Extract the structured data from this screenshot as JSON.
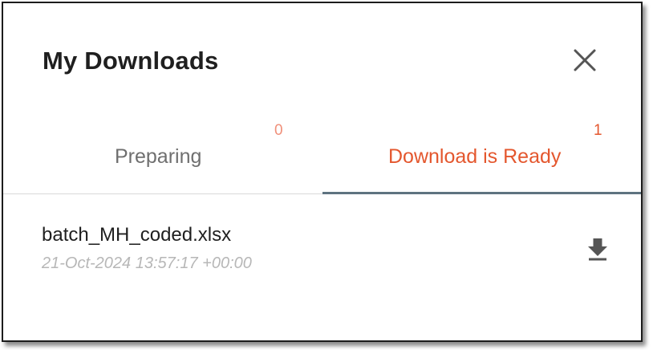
{
  "dialog": {
    "title": "My Downloads",
    "close_icon": "close-icon"
  },
  "tabs": [
    {
      "label": "Preparing",
      "count": "0",
      "active": false
    },
    {
      "label": "Download is Ready",
      "count": "1",
      "active": true
    }
  ],
  "downloads": [
    {
      "file_name": "batch_MH_coded.xlsx",
      "timestamp": "21-Oct-2024 13:57:17 +00:00",
      "action_icon": "download-icon"
    }
  ],
  "colors": {
    "accent": "#e4572e",
    "accent_light": "#f0907a",
    "indicator": "#5e7380",
    "title": "#1f1f1f",
    "muted": "#b7b7b7"
  }
}
